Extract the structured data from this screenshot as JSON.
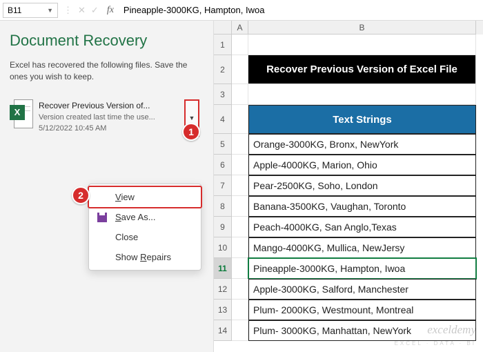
{
  "formula_bar": {
    "name_box": "B11",
    "fx": "fx",
    "value": "Pineapple-3000KG, Hampton, Iwoa"
  },
  "recovery": {
    "title": "Document Recovery",
    "desc": "Excel has recovered the following files. Save the ones you wish to keep.",
    "file": {
      "name": "Recover Previous Version of...",
      "version": "Version created last time the use...",
      "date": "5/12/2022 10:45 AM"
    },
    "menu": {
      "view": "View",
      "save_as": "Save As...",
      "close": "Close",
      "show_repairs": "Show Repairs"
    },
    "badge1": "1",
    "badge2": "2"
  },
  "columns": {
    "A": "A",
    "B": "B"
  },
  "rows": [
    "1",
    "2",
    "3",
    "4",
    "5",
    "6",
    "7",
    "8",
    "9",
    "10",
    "11",
    "12",
    "13",
    "14"
  ],
  "sheet": {
    "title": "Recover Previous Version of Excel File",
    "header": "Text Strings",
    "data": [
      "Orange-3000KG, Bronx, NewYork",
      "Apple-4000KG, Marion, Ohio",
      "Pear-2500KG, Soho, London",
      "Banana-3500KG, Vaughan, Toronto",
      "Peach-4000KG, San Anglo,Texas",
      "Mango-4000KG, Mullica, NewJersy",
      "Pineapple-3000KG, Hampton, Iwoa",
      "Apple-3000KG, Salford, Manchester",
      "Plum- 2000KG, Westmount, Montreal",
      "Plum- 3000KG, Manhattan, NewYork"
    ]
  },
  "watermark": {
    "main": "exceldemy",
    "sub": "EXCEL · DATA · BI"
  }
}
